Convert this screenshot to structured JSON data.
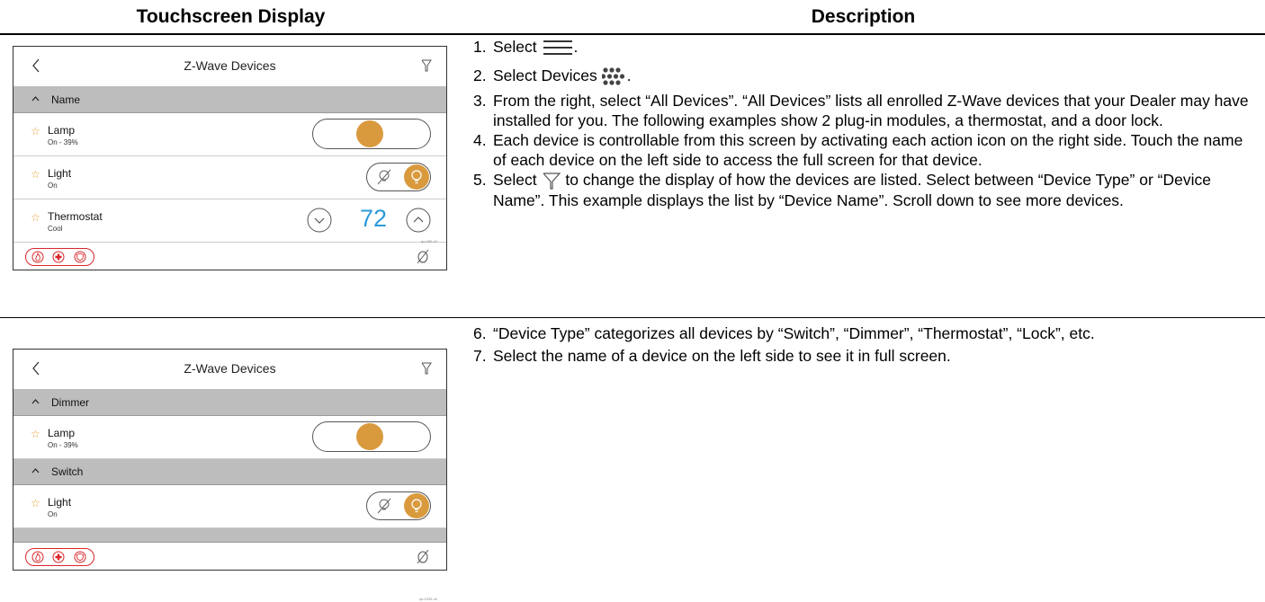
{
  "header": {
    "left": "Touchscreen Display",
    "right": "Description"
  },
  "screen1": {
    "title": "Z-Wave Devices",
    "group": "Name",
    "rows": [
      {
        "name": "Lamp",
        "status": "On - 39%",
        "control": "dimmer"
      },
      {
        "name": "Light",
        "status": "On",
        "control": "switch"
      },
      {
        "name": "Thermostat",
        "status": "Cool",
        "control": "thermostat",
        "setpoint": "72"
      }
    ],
    "code": "qs-085-v0"
  },
  "screen2": {
    "title": "Z-Wave Devices",
    "groups": [
      {
        "label": "Dimmer",
        "row": {
          "name": "Lamp",
          "status": "On - 39%"
        }
      },
      {
        "label": "Switch",
        "row": {
          "name": "Light",
          "status": "On"
        }
      }
    ],
    "code": "qs-0334-v0"
  },
  "description": {
    "step1_pre": "1.",
    "step1_text": "Select",
    "step2_text": "Select Devices",
    "step3": "From the right, select “All Devices”.  “All Devices” lists all enrolled Z-Wave devices that your Dealer may have installed for you.  The following examples show 2 plug-in modules, a thermostat, and a door lock.",
    "step4": "Each device is controllable from this screen by activating each action icon on the right side.  Touch the name of each device on the left side to access the full screen for that device.",
    "step5_pre": "Select",
    "step5_post": "to change the display of how the devices are listed.  Select between “Device Type” or “Device Name”.  This example displays the list by “Device Name”.  Scroll down to see more devices.",
    "step6": "“Device Type” categorizes all devices by “Switch”, “Dimmer”, “Thermostat”, “Lock”, etc.",
    "step7": "Select the name of a device on the left side to see it in full screen.",
    "nums": [
      "1.",
      "2.",
      "3.",
      "4.",
      "5.",
      "6.",
      "7."
    ]
  },
  "colors": {
    "accent_orange": "#d99a3e",
    "setpoint_blue": "#2b9ad8",
    "alarm_red": "#d9262b",
    "group_gray": "#bdbdbd"
  },
  "icons": [
    "back-chevron-icon",
    "filter-icon",
    "star-icon",
    "bulb-icon",
    "bulb-off-icon",
    "chevron-up-icon",
    "chevron-down-icon",
    "fire-icon",
    "medical-icon",
    "police-icon",
    "mute-icon",
    "menu-icon",
    "devices-grid-icon"
  ]
}
